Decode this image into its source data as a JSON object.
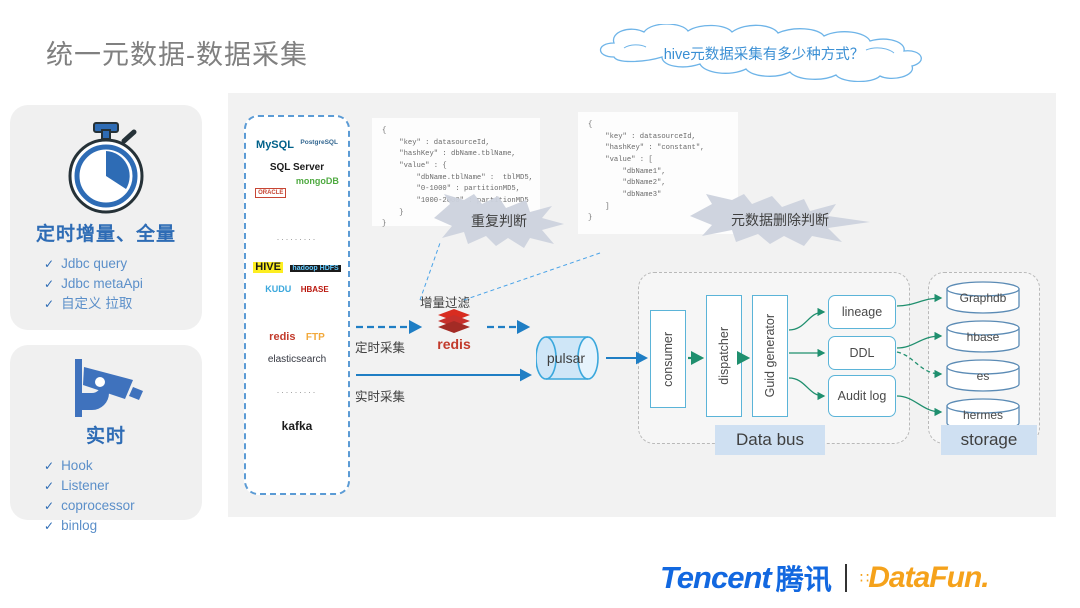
{
  "slide": {
    "title": "统一元数据-数据采集"
  },
  "cloud": {
    "text": "hive元数据采集有多少种方式？",
    "color": "#3a8fd4"
  },
  "cards": [
    {
      "id": "scheduled",
      "icon": "stopwatch-icon",
      "title": "定时增量、全量",
      "items": [
        "Jdbc query",
        "Jdbc metaApi",
        "自定义 拉取"
      ]
    },
    {
      "id": "realtime",
      "icon": "surveillance-camera-icon",
      "title": "实时",
      "items": [
        "Hook",
        "Listener",
        "coprocessor",
        "binlog"
      ]
    }
  ],
  "sources": {
    "logos": [
      "MySQL",
      "PostgreSQL",
      "SQL Server",
      "ORACLE",
      "mongoDB",
      "HIVE",
      "hadoop HDFS",
      "KUDU",
      "HBASE",
      "redis",
      "FTP",
      "elasticsearch",
      "kafka"
    ],
    "separator": "........."
  },
  "code_blocks": {
    "left": "{\n    \"key\" : datasourceId,\n    \"hashKey\" : dbName.tblName,\n    \"value\" : {\n        \"dbName.tblName\" :  tblMD5,\n        \"0-1000\" : partitionMD5,\n        \"1000-2000\" : partitionMD5\n    }\n}",
    "right": "{\n    \"key\" : datasourceId,\n    \"hashKey\" : \"constant\",\n    \"value\" : [\n        \"dbName1\",\n        \"dbName2\",\n        \"dbName3\"\n    ]\n}"
  },
  "bursts": {
    "duplicate": "重复判断",
    "delete": "元数据删除判断"
  },
  "flow": {
    "incremental_filter": "增量过滤",
    "scheduled_collect": "定时采集",
    "realtime_collect": "实时采集",
    "redis": "redis",
    "pulsar": "pulsar"
  },
  "databus": {
    "caption": "Data bus",
    "stages": [
      "consumer",
      "dispatcher",
      "Guid generator"
    ],
    "outputs": [
      "lineage",
      "DDL",
      "Audit log"
    ]
  },
  "storage": {
    "caption": "storage",
    "stores": [
      "Graphdb",
      "hbase",
      "es",
      "hermes"
    ]
  },
  "footer": {
    "tencent_en": "Tencent",
    "tencent_cn": "腾讯",
    "datafun": "DataFun.",
    "tencent_color": "#1268e0",
    "datafun_color": "#f5a21b"
  }
}
